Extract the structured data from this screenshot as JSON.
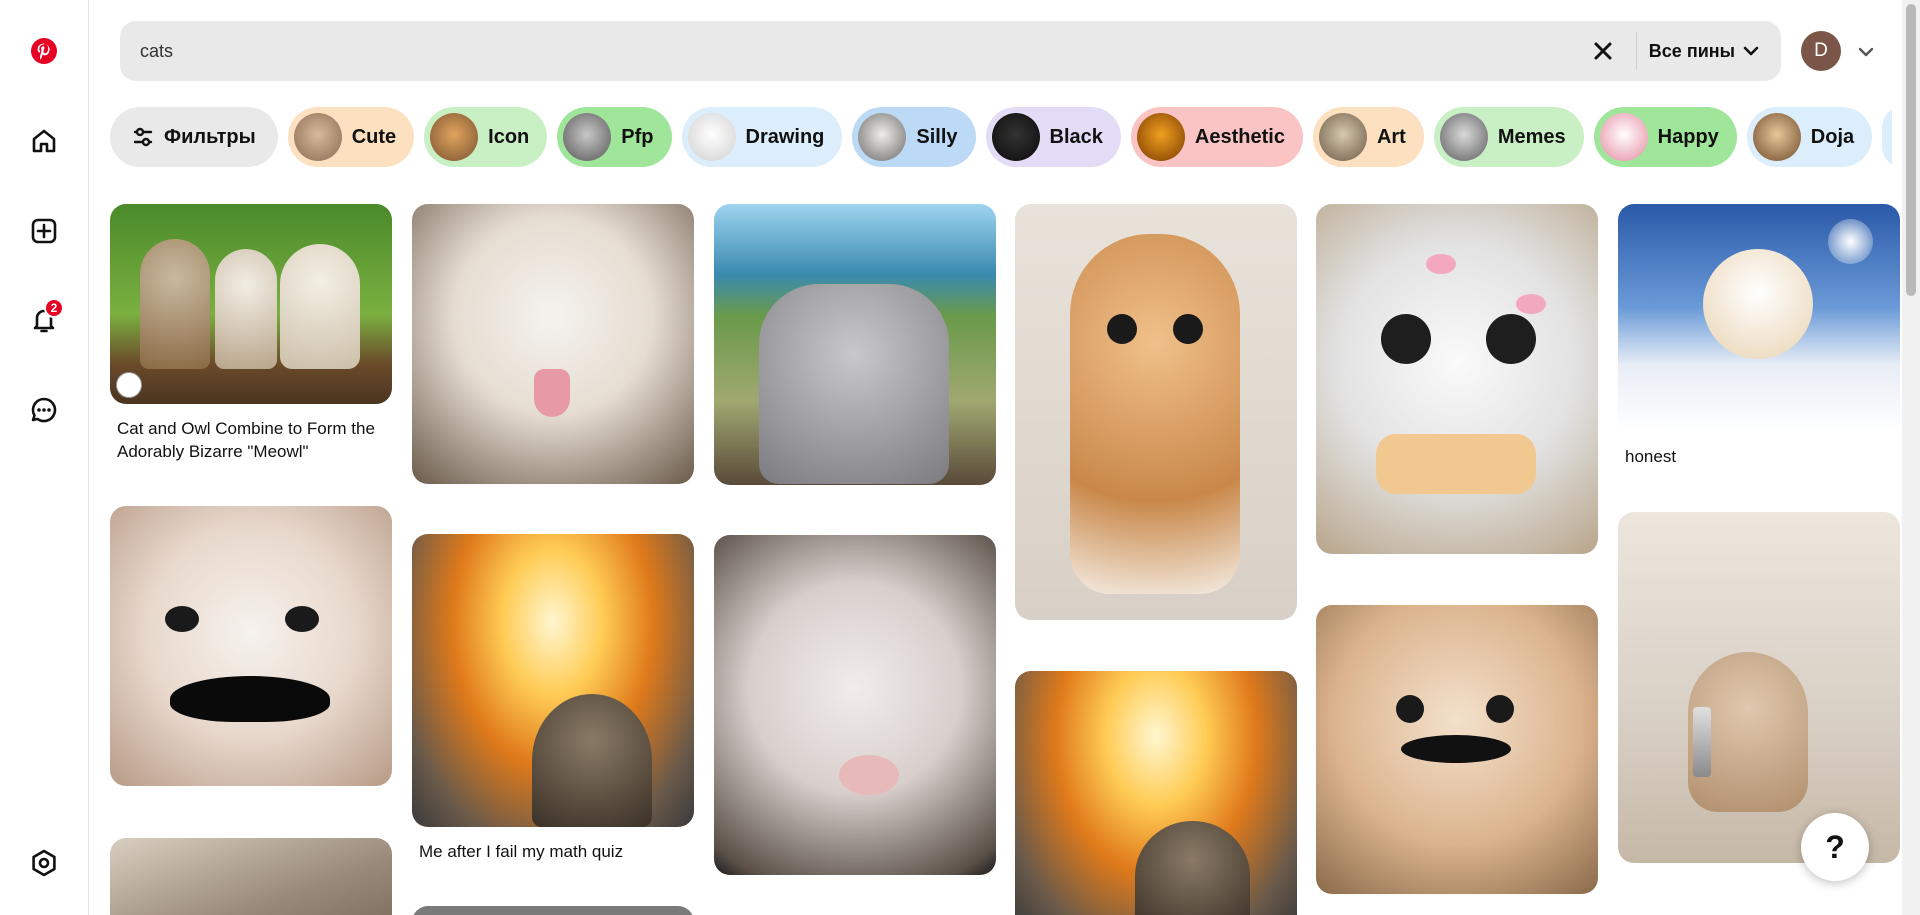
{
  "search": {
    "value": "cats",
    "scope_label": "Все пины"
  },
  "account": {
    "initial": "D"
  },
  "notifications": {
    "badge_count": "2"
  },
  "filters_label": "Фильтры",
  "chips": [
    {
      "label": "Cute",
      "color": "#fde0c0"
    },
    {
      "label": "Icon",
      "color": "#c9f0c5"
    },
    {
      "label": "Pfp",
      "color": "#9fe59a"
    },
    {
      "label": "Drawing",
      "color": "#dceefb"
    },
    {
      "label": "Silly",
      "color": "#bcd9f5"
    },
    {
      "label": "Black",
      "color": "#e3dcf7"
    },
    {
      "label": "Aesthetic",
      "color": "#fbc4c4"
    },
    {
      "label": "Art",
      "color": "#fde0c0"
    },
    {
      "label": "Memes",
      "color": "#c9f0c5"
    },
    {
      "label": "Happy",
      "color": "#9fe59a"
    },
    {
      "label": "Doja",
      "color": "#dceefb"
    }
  ],
  "pins": [
    {
      "title": "Cat and Owl Combine to Form the Adorably Bizarre \"Meowl\""
    },
    {
      "title": ""
    },
    {
      "title": ""
    },
    {
      "title": ""
    },
    {
      "title": ""
    },
    {
      "title": "honest"
    },
    {
      "title": ""
    },
    {
      "title": "Me after I fail my math quiz"
    },
    {
      "title": ""
    },
    {
      "title": ""
    },
    {
      "title": ""
    },
    {
      "title": ""
    },
    {
      "title": ""
    },
    {
      "title": ""
    }
  ],
  "help_label": "?"
}
